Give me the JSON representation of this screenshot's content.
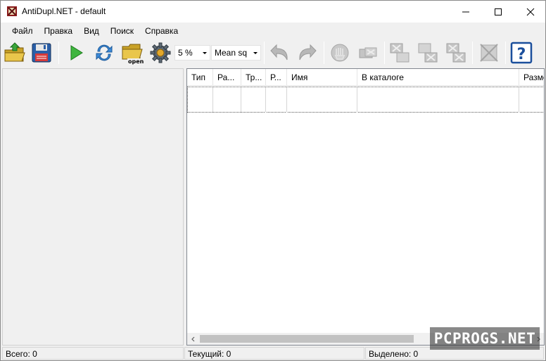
{
  "window": {
    "title": "AntiDupl.NET - default",
    "icon": "app-icon"
  },
  "menu": {
    "items": [
      "Файл",
      "Правка",
      "Вид",
      "Поиск",
      "Справка"
    ]
  },
  "toolbar": {
    "threshold_value": "5 %",
    "compare_method_value": "Mean sq",
    "open_label": "open",
    "help_label": "?",
    "buttons": [
      "open-folder-icon",
      "save-icon",
      "play-icon",
      "refresh-icon",
      "open-profile-icon",
      "settings-gear-icon",
      "undo-icon",
      "redo-icon",
      "mistake-icon",
      "delete-pair-icon",
      "delete-first-icon",
      "delete-second-icon",
      "delete-both-icon",
      "disabled-delete-icon",
      "help-icon"
    ]
  },
  "list": {
    "columns": [
      "Тип",
      "Ра...",
      "Тр...",
      "Р...",
      "Имя",
      "В каталоге",
      "Разме"
    ]
  },
  "status": {
    "total": "Всего: 0",
    "current": "Текущий: 0",
    "selected": "Выделено: 0"
  },
  "watermark": {
    "text": "PCPROGS.NET"
  },
  "colors": {
    "accent": "#2f78d0",
    "window_bg": "#f0f0f0"
  }
}
